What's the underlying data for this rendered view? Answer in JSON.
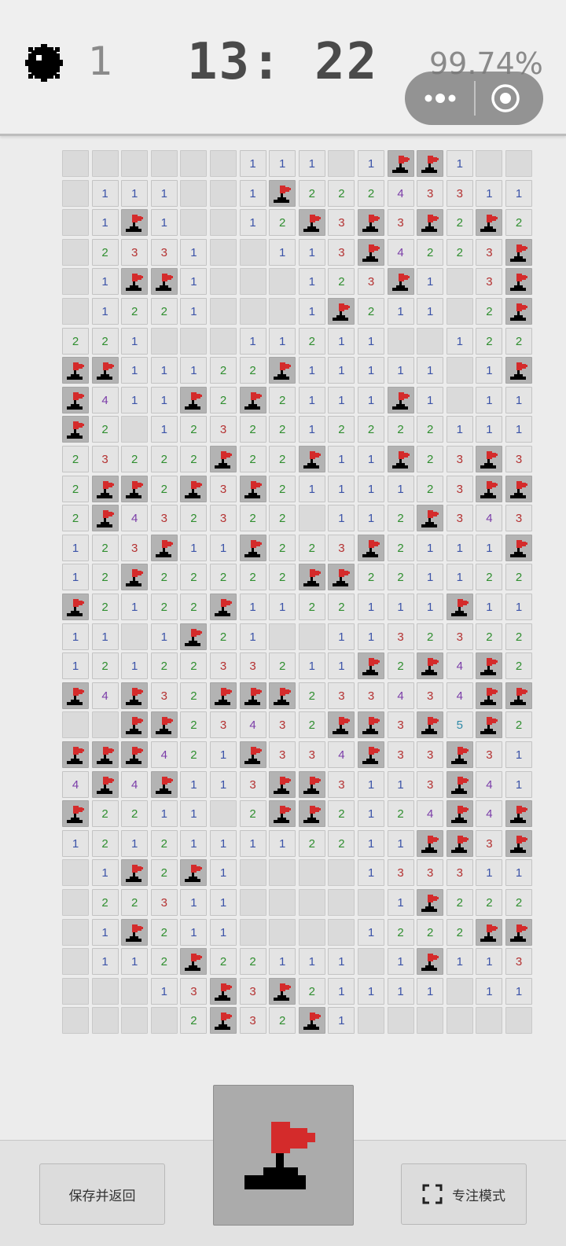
{
  "header": {
    "mine_icon": "mine-icon",
    "mines_remaining": "1",
    "timer": "13: 22",
    "progress": "99.74%"
  },
  "capsule": {
    "more_icon": "more-dots-icon",
    "close_icon": "target-close-icon"
  },
  "board": {
    "columns": 16,
    "rows": 30,
    "legend": "H = hidden/unopened, 0 = opened empty, F = flag, digit = neighbouring mine count",
    "grid": [
      "HHHHHH111H1FF1HH",
      "H111HH1F2224331 1",
      "H1F1HH12F3F3F2F2",
      "H2331HH113F4223F",
      "H1FF1HHH123F1H3F",
      "H1221HHH1F211H2F",
      "221HHH11211HH122",
      "FF11122F11111H1F1",
      "F411F2F2111F1H111",
      "F2H1232212222111",
      "2322 2F22F11F23F3",
      "2FF2F3F211112 3FFF",
      "2F4323 22H112F343",
      "123F11F2 23F2111F",
      "12F22222FF22112 2",
      "F2122F1122111F11F",
      "11H1F21HH113232 2",
      "1212233211F2F4F2",
      "F4F32FFF233434FF3",
      "HHFF2343 2FF3F5F2",
      "FFF421F334F33F31",
      "4F4F113FF311 3F41",
      "F22 11H2FF212 4F4F",
      "121211112211FF3F2",
      "H1F2F1HHHH1333 11",
      "H2231 1HHHHH1F222",
      "H1F211HHHH1222FF",
      "H112F22111H1F113F",
      "HHH13F3F2111 1H11",
      "HHHH2F32F1HHHHHH"
    ]
  },
  "buttons": {
    "save_label": "保存并返回",
    "focus_label": "专注模式",
    "mode_icon": "flag-mode-icon",
    "focus_icon": "focus-frame-icon"
  },
  "colors": {
    "flag_red": "#d42b2b",
    "n1": "#3b53a8",
    "n2": "#2f8e2f",
    "n3": "#b43131",
    "n4": "#7a3ca8",
    "n5": "#2f8aa8"
  }
}
